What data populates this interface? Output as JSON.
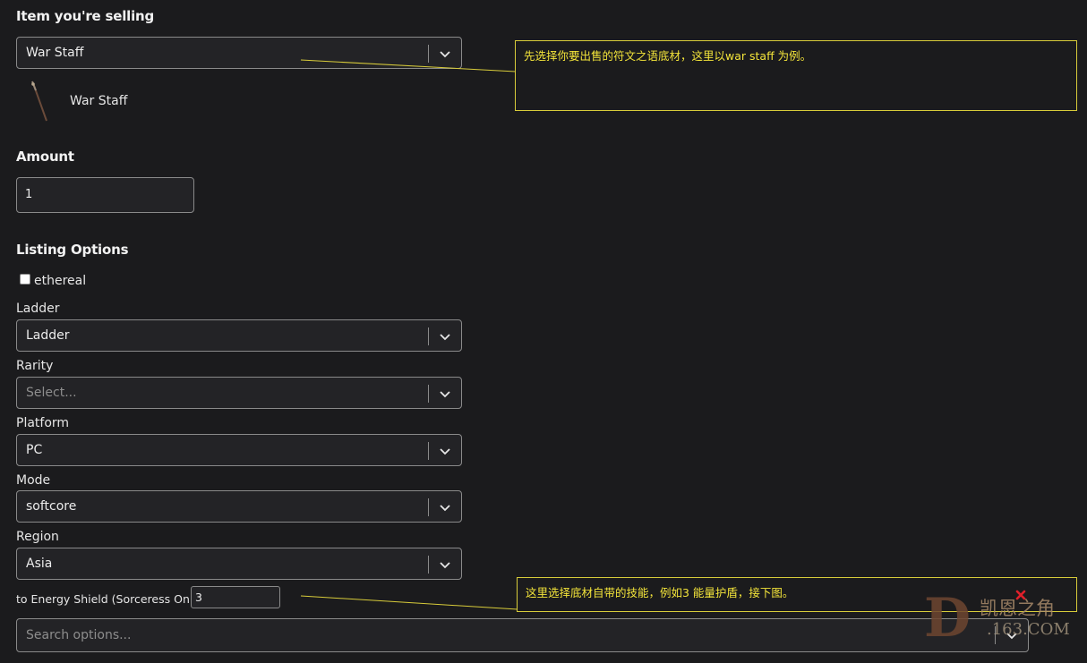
{
  "item_section": {
    "heading": "Item you're selling",
    "selected": "War Staff",
    "preview_name": "War Staff"
  },
  "amount_section": {
    "heading": "Amount",
    "value": "1"
  },
  "listing_options": {
    "heading": "Listing Options",
    "ethereal_label": "ethereal",
    "ladder": {
      "label": "Ladder",
      "value": "Ladder"
    },
    "rarity": {
      "label": "Rarity",
      "placeholder": "Select..."
    },
    "platform": {
      "label": "Platform",
      "value": "PC"
    },
    "mode": {
      "label": "Mode",
      "value": "softcore"
    },
    "region": {
      "label": "Region",
      "value": "Asia"
    }
  },
  "skill": {
    "label": "to Energy Shield (Sorceress Only)",
    "value": "3"
  },
  "search_options": {
    "placeholder": "Search options..."
  },
  "annotations": {
    "note1": "先选择你要出售的符文之语底材，这里以war staff 为例。",
    "note2": "这里选择底材自带的技能，例如3 能量护盾，接下图。"
  },
  "watermark": {
    "text": "凯恩之角",
    "sub": ".163.COM",
    "letter": "D"
  },
  "colors": {
    "background": "#1b1b1d",
    "annotation": "#f3e43a",
    "close_mark": "#e0202a"
  }
}
